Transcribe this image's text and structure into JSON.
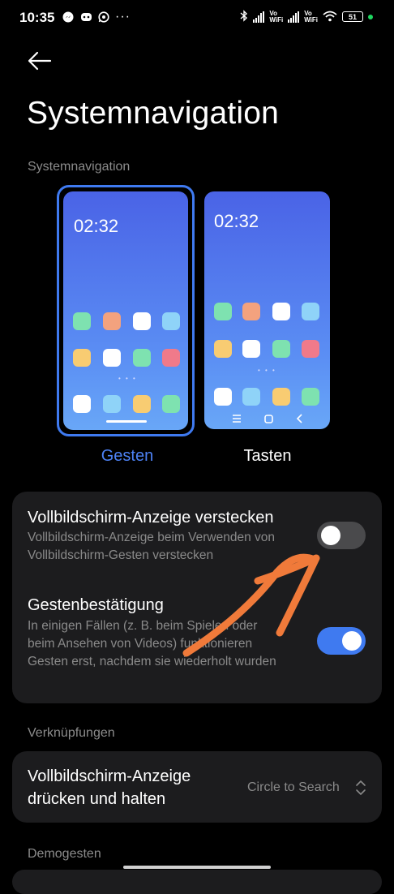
{
  "status_bar": {
    "time": "10:35",
    "left_icons": [
      "messenger-icon",
      "discord-icon",
      "whatsapp-icon",
      "more-dots-icon"
    ],
    "more": "···",
    "vowifi_1": "Vo\nWiFi",
    "vowifi_2": "Vo\nWiFi",
    "battery": "51"
  },
  "page": {
    "title": "Systemnavigation",
    "section_nav": "Systemnavigation",
    "section_shortcuts": "Verknüpfungen",
    "section_demo": "Demogesten"
  },
  "options": [
    {
      "label": "Gesten",
      "time": "02:32",
      "selected": true
    },
    {
      "label": "Tasten",
      "time": "02:32",
      "selected": false
    }
  ],
  "settings": {
    "hide_indicator": {
      "title": "Vollbildschirm-Anzeige verstecken",
      "subtitle": "Vollbildschirm-Anzeige beim Verwenden von Vollbildschirm-Gesten verstecken",
      "enabled": false
    },
    "gesture_confirm": {
      "title": "Gestenbestätigung",
      "subtitle": "In einigen Fällen (z. B. beim Spielen oder beim Ansehen von Videos) funktionieren Gesten erst, nachdem sie wiederholt wurden",
      "enabled": true
    },
    "press_hold": {
      "title_line1": "Vollbildschirm-Anzeige",
      "title_line2": "drücken und halten",
      "value": "Circle to Search"
    }
  },
  "colors": {
    "accent": "#3f7af0",
    "toggle_on": "#3f7af0",
    "toggle_off": "#4a4a4c",
    "annotation_arrow": "#f07a3a"
  }
}
